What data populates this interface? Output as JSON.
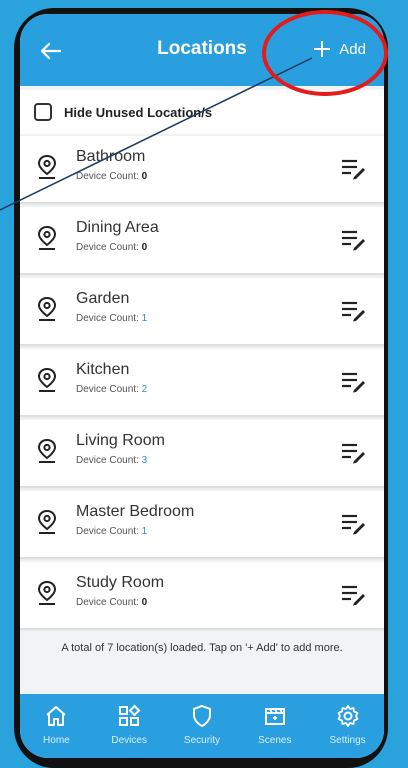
{
  "header": {
    "title": "Locations",
    "add_label": "Add"
  },
  "hide_unused_label": "Hide Unused Location/s",
  "locations": [
    {
      "name": "Bathroom",
      "count_label": "Device Count:",
      "count": "0"
    },
    {
      "name": "Dining Area",
      "count_label": "Device Count:",
      "count": "0"
    },
    {
      "name": "Garden",
      "count_label": "Device Count:",
      "count": "1"
    },
    {
      "name": "Kitchen",
      "count_label": "Device Count:",
      "count": "2"
    },
    {
      "name": "Living Room",
      "count_label": "Device Count:",
      "count": "3"
    },
    {
      "name": "Master Bedroom",
      "count_label": "Device Count:",
      "count": "1"
    },
    {
      "name": "Study Room",
      "count_label": "Device Count:",
      "count": "0"
    }
  ],
  "footer_note": "A total of 7 location(s) loaded. Tap on '+ Add' to add more.",
  "nav": [
    {
      "label": "Home",
      "icon": "home-icon"
    },
    {
      "label": "Devices",
      "icon": "devices-icon"
    },
    {
      "label": "Security",
      "icon": "shield-icon"
    },
    {
      "label": "Scenes",
      "icon": "scenes-icon"
    },
    {
      "label": "Settings",
      "icon": "gear-icon"
    }
  ],
  "colors": {
    "accent": "#2a9fe0",
    "annotation": "#e41b1b",
    "count_nonzero": "#2a8fd6"
  }
}
